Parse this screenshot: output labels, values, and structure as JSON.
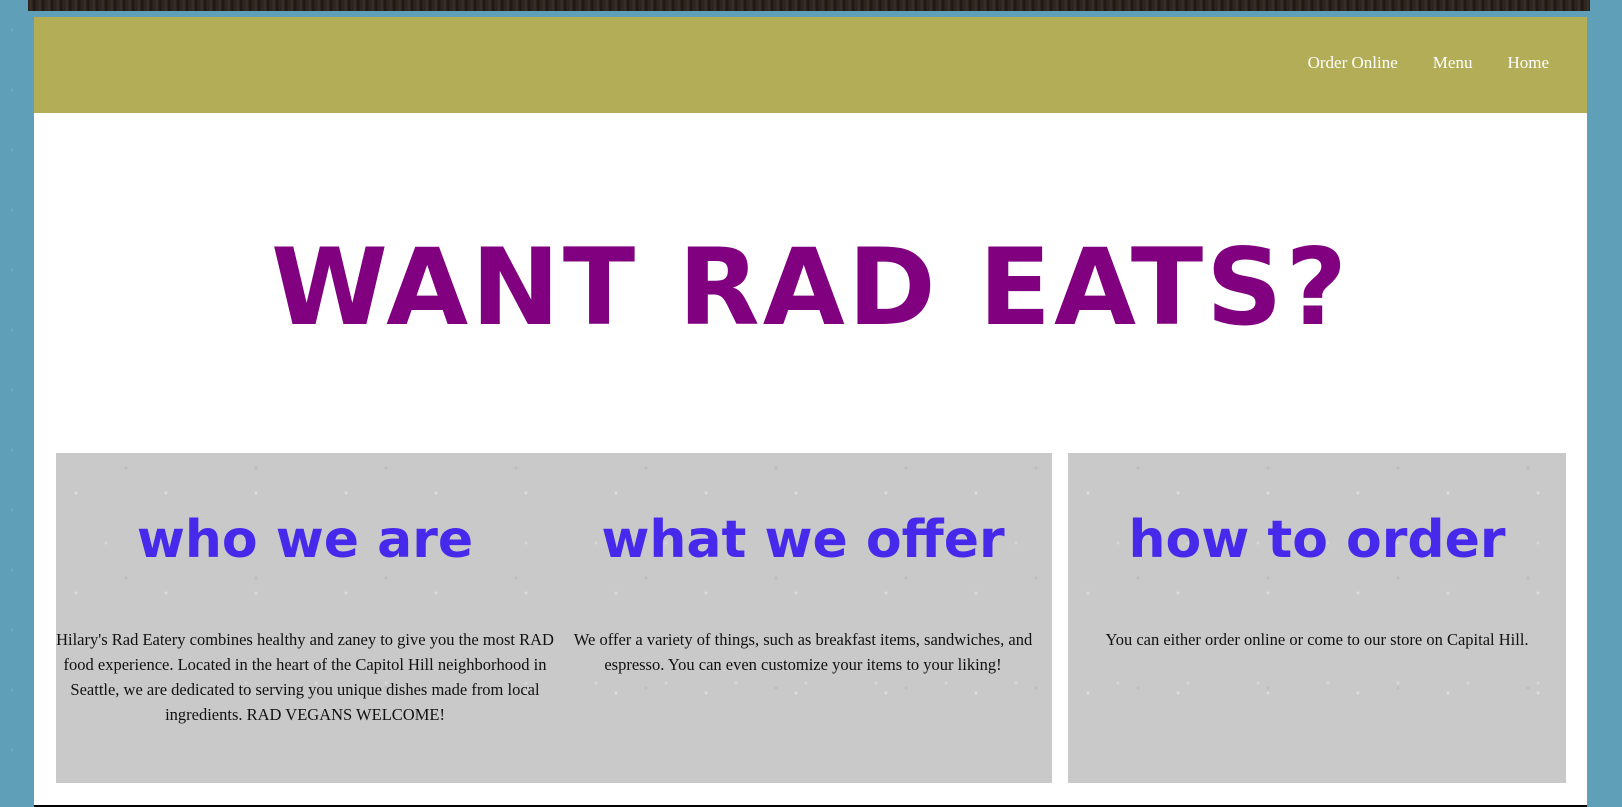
{
  "nav": {
    "items": [
      {
        "label": "Order Online"
      },
      {
        "label": "Menu"
      },
      {
        "label": "Home"
      }
    ]
  },
  "hero": {
    "title": "WANT RAD EATS?"
  },
  "sections": [
    {
      "heading": "who we are",
      "body": "Hilary's Rad Eatery combines healthy and zaney to give you the most RAD food experience. Located in the heart of the Capitol Hill neighborhood in Seattle, we are dedicated to serving you unique dishes made from local ingredients. RAD VEGANS WELCOME!"
    },
    {
      "heading": "what we offer",
      "body": "We offer a variety of things, such as breakfast items, sandwiches, and espresso. You can even customize your items to your liking!"
    },
    {
      "heading": "how to order",
      "body": "You can either order online or come to our store on Capital Hill."
    }
  ],
  "colors": {
    "header": "#b2ad56",
    "hero_title": "#800080",
    "section_heading": "#4629ea",
    "panel": "#c9c9c9",
    "background": "#5f9fb8"
  }
}
